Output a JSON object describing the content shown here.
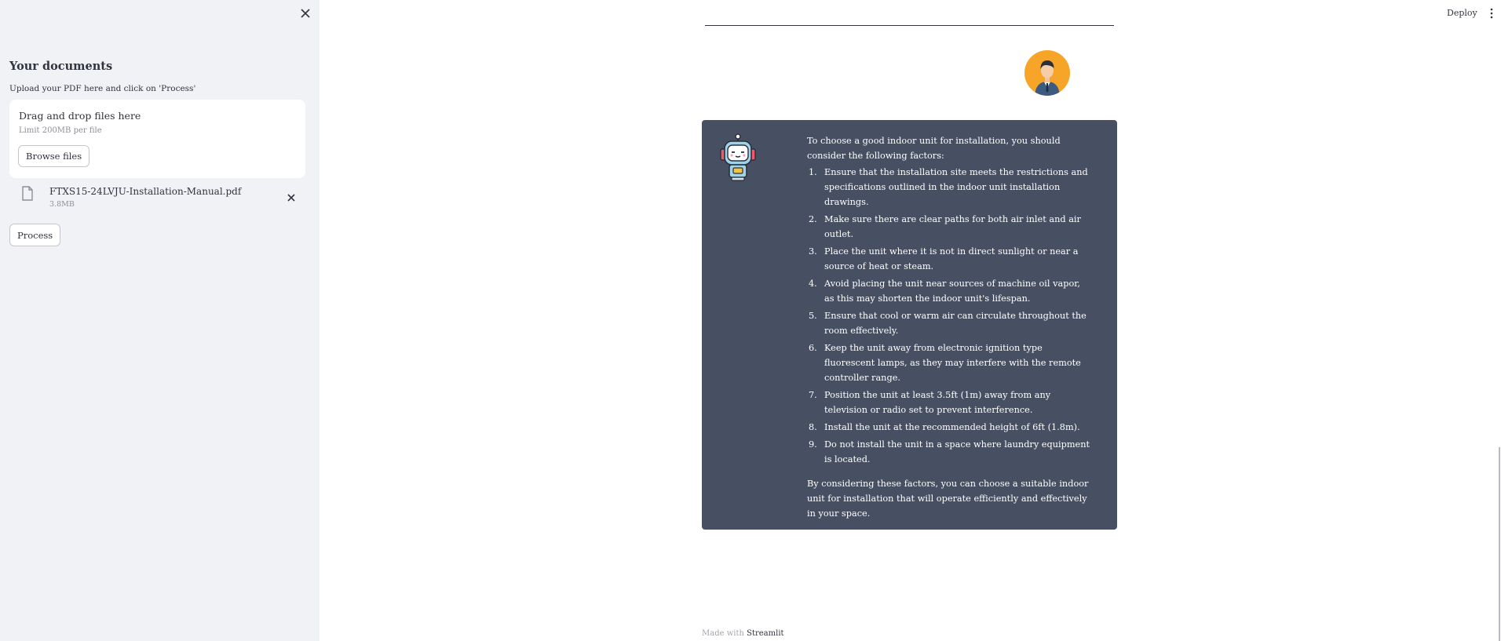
{
  "sidebar": {
    "title": "Your documents",
    "upload_label": "Upload your PDF here and click on 'Process'",
    "dropzone": {
      "title": "Drag and drop files here",
      "limit": "Limit 200MB per file",
      "browse_label": "Browse files"
    },
    "file": {
      "name": "FTXS15-24LVJU-Installation-Manual.pdf",
      "size": "3.8MB"
    },
    "process_label": "Process"
  },
  "header": {
    "deploy_label": "Deploy"
  },
  "chat": {
    "bot_message": {
      "intro": "To choose a good indoor unit for installation, you should consider the following factors:",
      "items": [
        {
          "num": "1.",
          "text": "Ensure that the installation site meets the restrictions and specifications outlined in the indoor unit installation drawings."
        },
        {
          "num": "2.",
          "text": "Make sure there are clear paths for both air inlet and air outlet."
        },
        {
          "num": "3.",
          "text": "Place the unit where it is not in direct sunlight or near a source of heat or steam."
        },
        {
          "num": "4.",
          "text": "Avoid placing the unit near sources of machine oil vapor, as this may shorten the indoor unit's lifespan."
        },
        {
          "num": "5.",
          "text": "Ensure that cool or warm air can circulate throughout the room effectively."
        },
        {
          "num": "6.",
          "text": "Keep the unit away from electronic ignition type fluorescent lamps, as they may interfere with the remote controller range."
        },
        {
          "num": "7.",
          "text": "Position the unit at least 3.5ft (1m) away from any television or radio set to prevent interference."
        },
        {
          "num": "8.",
          "text": "Install the unit at the recommended height of 6ft (1.8m)."
        },
        {
          "num": "9.",
          "text": "Do not install the unit in a space where laundry equipment is located."
        }
      ],
      "outro": "By considering these factors, you can choose a suitable indoor unit for installation that will operate efficiently and effectively in your space."
    }
  },
  "footer": {
    "prefix": "Made with",
    "brand": "Streamlit"
  },
  "colors": {
    "sidebar_bg": "#f0f2f6",
    "bot_card_bg": "#475063",
    "avatar_bg": "#f7a529"
  }
}
